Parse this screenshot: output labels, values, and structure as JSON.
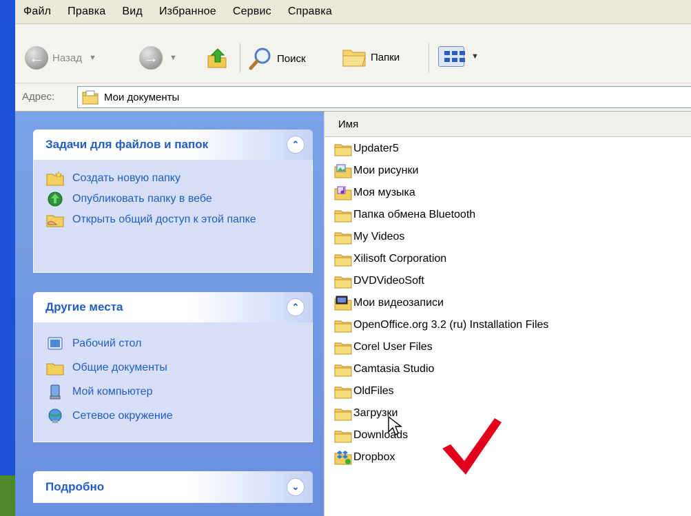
{
  "menu": [
    "Файл",
    "Правка",
    "Вид",
    "Избранное",
    "Сервис",
    "Справка"
  ],
  "toolbar": {
    "back_label": "Назад",
    "search_label": "Поиск",
    "folders_label": "Папки"
  },
  "address": {
    "label": "Адрес:",
    "value": "Мои документы"
  },
  "tasks_panel": {
    "title": "Задачи для файлов и папок",
    "items": [
      {
        "label": "Создать новую папку",
        "icon": "new-folder-icon"
      },
      {
        "label": "Опубликовать папку в вебе",
        "icon": "publish-web-icon"
      },
      {
        "label": "Открыть общий доступ к этой папке",
        "icon": "share-folder-icon"
      }
    ]
  },
  "other_places": {
    "title": "Другие места",
    "items": [
      {
        "label": "Рабочий стол",
        "icon": "desktop-icon"
      },
      {
        "label": "Общие документы",
        "icon": "folder-icon"
      },
      {
        "label": "Мой компьютер",
        "icon": "computer-icon"
      },
      {
        "label": "Сетевое окружение",
        "icon": "network-icon"
      }
    ]
  },
  "details_panel": {
    "title": "Подробно"
  },
  "file_list": {
    "column_name": "Имя",
    "items": [
      {
        "name": "Updater5",
        "icon": "folder-icon"
      },
      {
        "name": "Мои рисунки",
        "icon": "pictures-folder-icon"
      },
      {
        "name": "Моя музыка",
        "icon": "music-folder-icon"
      },
      {
        "name": "Папка обмена Bluetooth",
        "icon": "folder-icon"
      },
      {
        "name": "My Videos",
        "icon": "folder-icon"
      },
      {
        "name": "Xilisoft Corporation",
        "icon": "folder-icon"
      },
      {
        "name": "DVDVideoSoft",
        "icon": "folder-icon"
      },
      {
        "name": "Мои видеозаписи",
        "icon": "video-folder-icon"
      },
      {
        "name": "OpenOffice.org 3.2 (ru) Installation Files",
        "icon": "folder-icon"
      },
      {
        "name": "Corel User Files",
        "icon": "folder-icon"
      },
      {
        "name": "Camtasia Studio",
        "icon": "folder-icon"
      },
      {
        "name": "OldFiles",
        "icon": "folder-icon"
      },
      {
        "name": "Загрузки",
        "icon": "folder-icon"
      },
      {
        "name": "Downloads",
        "icon": "folder-icon"
      },
      {
        "name": "Dropbox",
        "icon": "dropbox-folder-icon"
      }
    ]
  },
  "colors": {
    "task_link": "#215dc6",
    "pane_bg": "#7ba2e7",
    "checkmark": "#e0001b"
  }
}
